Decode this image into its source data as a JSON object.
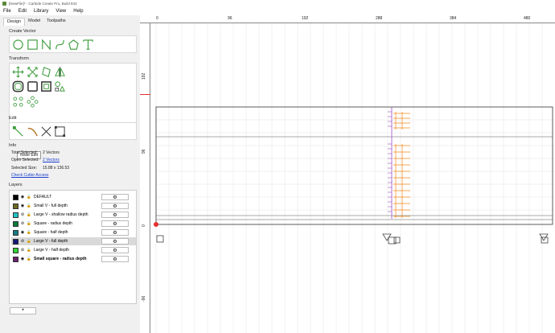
{
  "window": {
    "title": "[NewFile]* - Carbide Create Pro, Build 843"
  },
  "menu": [
    "File",
    "Edit",
    "Library",
    "View",
    "Help"
  ],
  "tabs": [
    "Design",
    "Model",
    "Toolpaths"
  ],
  "sections": {
    "create_vector": "Create Vector",
    "transform": "Transform",
    "edit": "Edit",
    "info": "Info",
    "layers": "Layers"
  },
  "tooltip": "Node Edit",
  "info": {
    "total_selected_label": "Total Selected:",
    "total_selected_value": "2 Vectors",
    "open_selected_label": "Open Selected:",
    "open_selected_value": "2 Vectors",
    "selected_size_label": "Selected Size:",
    "selected_size_value": "15.88 x 136.53",
    "check_cutter": "Check Cutter Access"
  },
  "layers": [
    {
      "name": "DEFAULT",
      "color": "#000000",
      "bold": false,
      "selected": false,
      "visible": true
    },
    {
      "name": "Small V - full depth",
      "color": "#6b6b1f",
      "bold": false,
      "selected": false,
      "visible": true
    },
    {
      "name": "Large V - shallow radius depth",
      "color": "#21c3c3",
      "bold": false,
      "selected": false,
      "visible": false
    },
    {
      "name": "Square - radius depth",
      "color": "#0b7a3a",
      "bold": false,
      "selected": false,
      "visible": false
    },
    {
      "name": "Square - half depth",
      "color": "#177c83",
      "bold": false,
      "selected": false,
      "visible": true
    },
    {
      "name": "Large V - full depth",
      "color": "#16167a",
      "bold": false,
      "selected": true,
      "visible": false
    },
    {
      "name": "Large V - half depth",
      "color": "#33d133",
      "bold": false,
      "selected": false,
      "visible": false
    },
    {
      "name": "Small square - radius depth",
      "color": "#6b1f6b",
      "bold": true,
      "selected": false,
      "visible": true
    }
  ],
  "add_layer": "+",
  "ruler": {
    "x_labels": [
      "0",
      "96",
      "192",
      "288",
      "384",
      "480"
    ],
    "y_labels": [
      "192",
      "96",
      "0",
      "-96"
    ]
  },
  "colors": {
    "icon_green": "#3a9a3a",
    "purple_vector": "#9b4fc9",
    "orange_vector": "#f08a1e",
    "stock_outline": "#333333"
  }
}
